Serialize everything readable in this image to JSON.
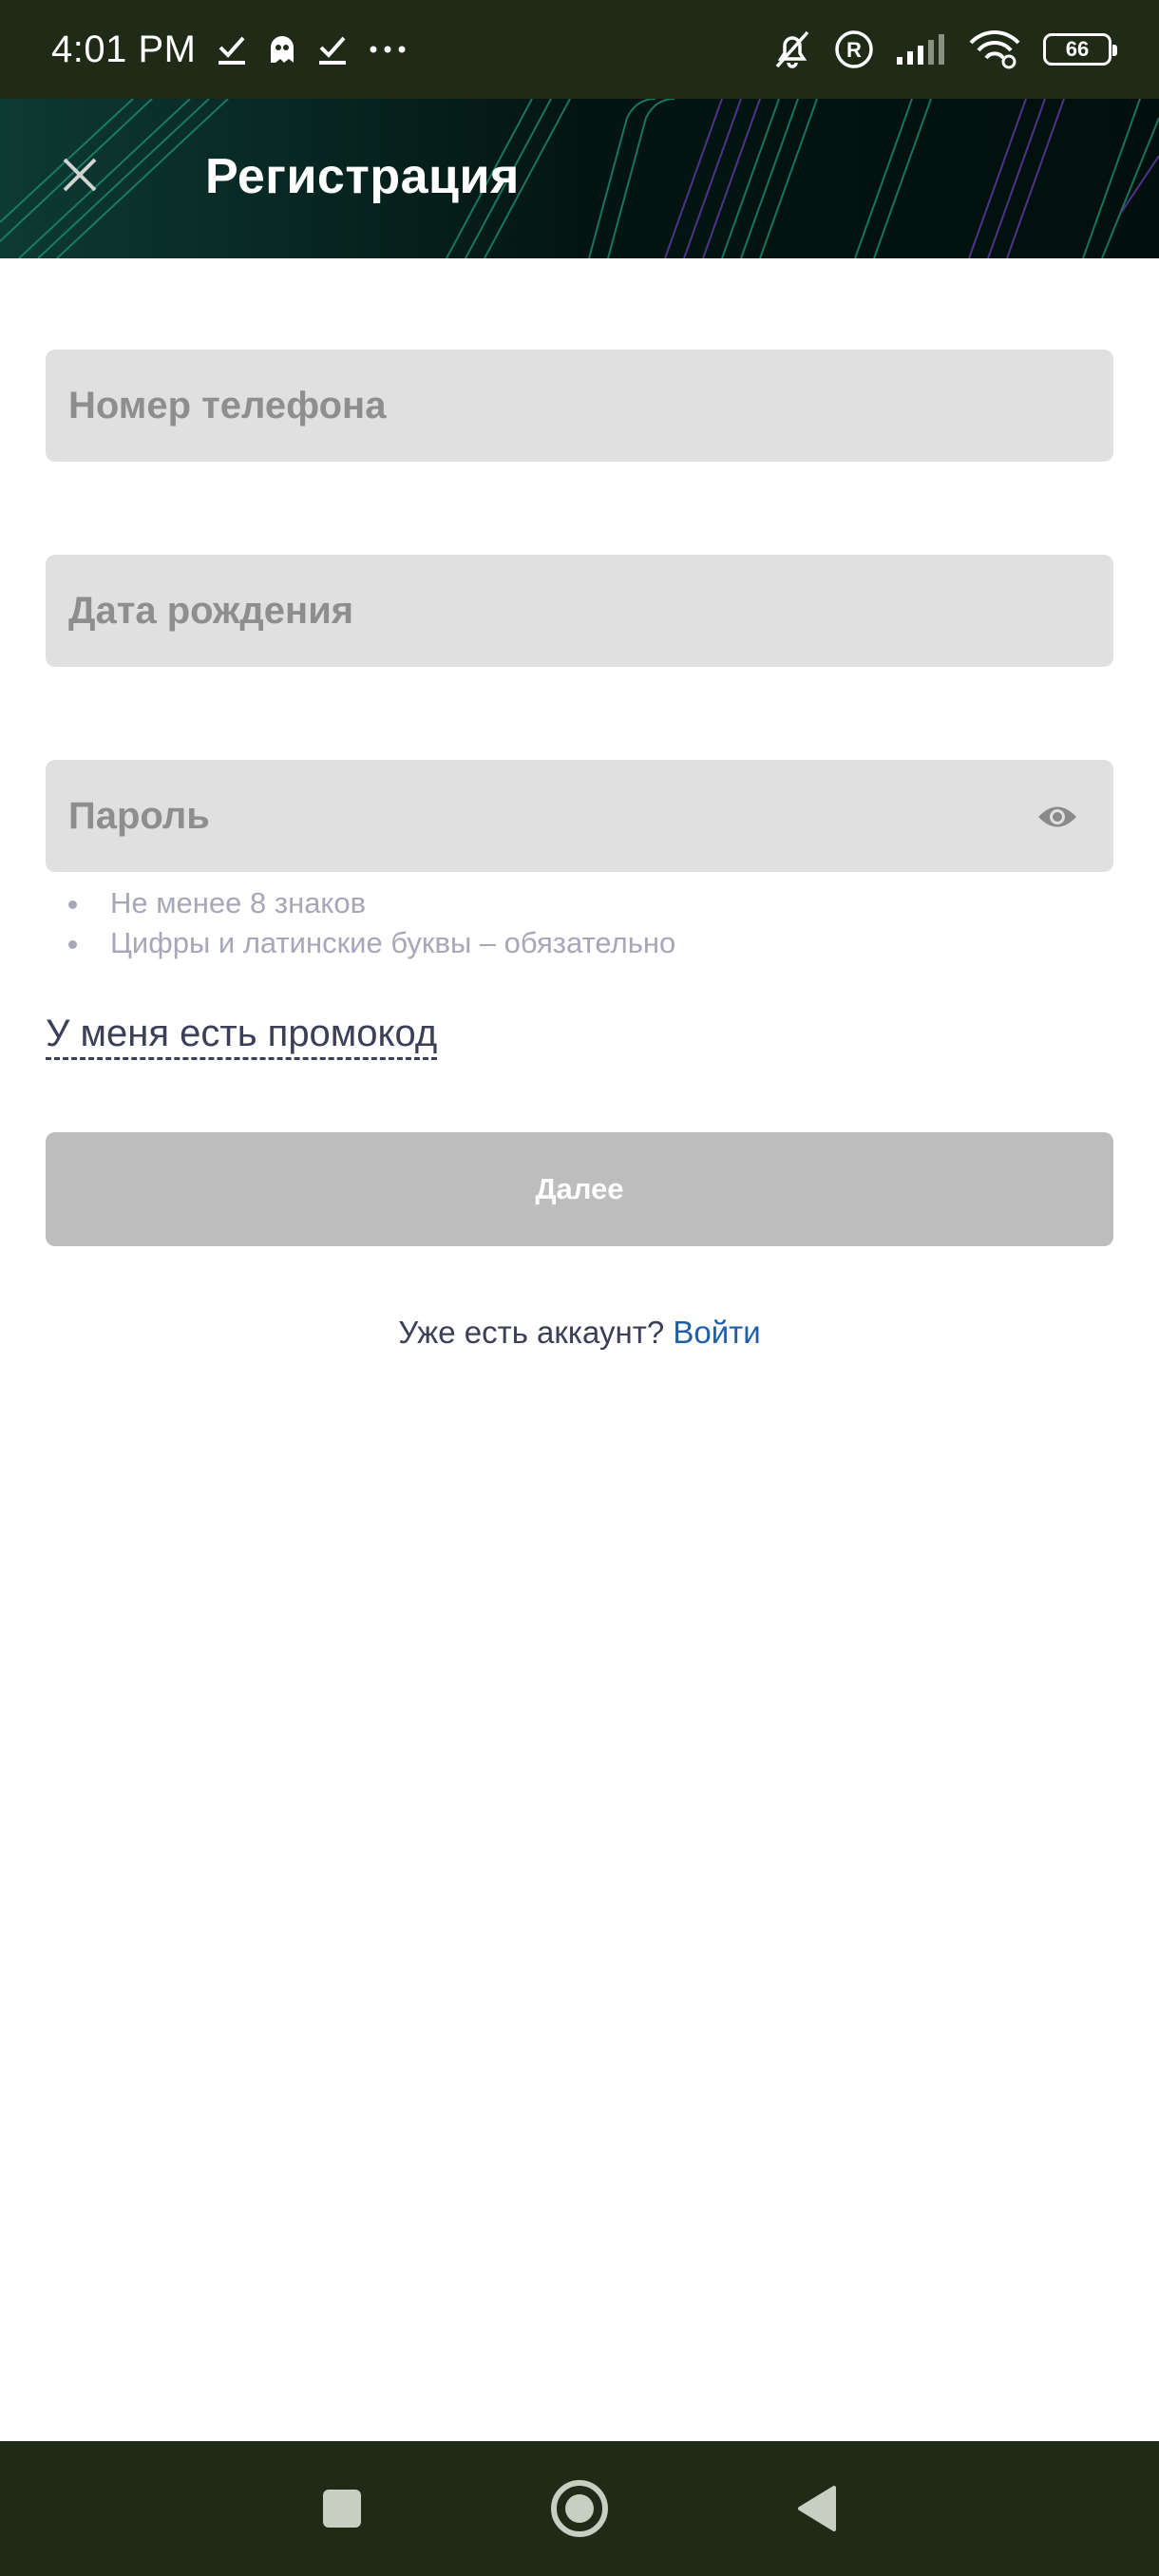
{
  "status_bar": {
    "time": "4:01 PM",
    "left_icons": [
      "download-check-icon",
      "ghost-icon",
      "download-check-icon",
      "more-dots-icon"
    ],
    "right_icons": [
      "muted-bell-icon",
      "registered-icon",
      "signal-icon",
      "wifi-icon"
    ],
    "battery_level": "66"
  },
  "header": {
    "title": "Регистрация",
    "close_icon": "close-icon"
  },
  "form": {
    "phone_placeholder": "Номер телефона",
    "birthdate_placeholder": "Дата рождения",
    "password_placeholder": "Пароль",
    "password_toggle_icon": "eye-icon",
    "password_hints": [
      "Не менее 8 знаков",
      "Цифры и латинские буквы – обязательно"
    ],
    "promo_link": "У меня есть промокод",
    "next_button": "Далее"
  },
  "footer": {
    "have_account": "Уже есть аккаунт?",
    "login_link": "Войти"
  },
  "nav_bar": {
    "buttons": [
      "recents-square-icon",
      "home-circle-icon",
      "back-triangle-icon"
    ]
  },
  "colors": {
    "status_bar_bg": "#1f2a17",
    "header_bg": "#051512",
    "field_bg": "#e0e0e0",
    "button_disabled": "#bdbdbd",
    "link_blue": "#1e5fa8",
    "text_dark": "#3b3f57",
    "hint_gray": "#a7a7ba"
  }
}
